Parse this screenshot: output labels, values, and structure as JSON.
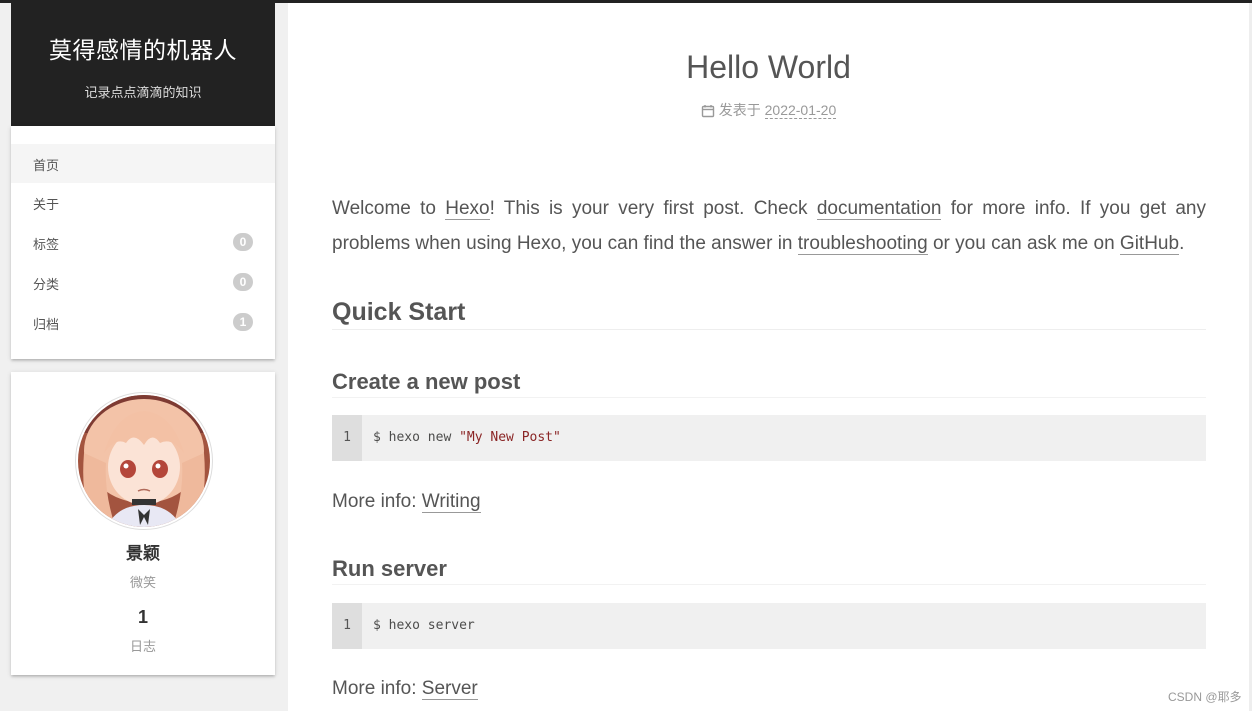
{
  "site": {
    "title": "莫得感情的机器人",
    "subtitle": "记录点点滴滴的知识"
  },
  "menu": {
    "items": [
      {
        "label": "首页",
        "badge": null
      },
      {
        "label": "关于",
        "badge": null
      },
      {
        "label": "标签",
        "badge": "0"
      },
      {
        "label": "分类",
        "badge": "0"
      },
      {
        "label": "归档",
        "badge": "1"
      }
    ]
  },
  "profile": {
    "name": "景颖",
    "description": "微笑",
    "posts_count": "1",
    "posts_label": "日志"
  },
  "post": {
    "title": "Hello World",
    "meta_prefix": "发表于",
    "date": "2022-01-20",
    "intro": {
      "t1": "Welcome to ",
      "link_hexo": "Hexo",
      "t2": "! This is your very first post. Check ",
      "link_docs": "documentation",
      "t3": " for more info. If you get any problems when using Hexo, you can find the answer in ",
      "link_trouble": "troubleshooting",
      "t4": " or you can ask me on ",
      "link_github": "GitHub",
      "t5": "."
    },
    "h_quick_start": "Quick Start",
    "h_create": "Create a new post",
    "code1": {
      "line": "1",
      "cmd": "$ hexo new ",
      "arg": "\"My New Post\""
    },
    "more1": {
      "prefix": "More info: ",
      "link": "Writing"
    },
    "h_run": "Run server",
    "code2": {
      "line": "1",
      "cmd": "$ hexo server"
    },
    "more2": {
      "prefix": "More info: ",
      "link": "Server"
    }
  },
  "watermark": "CSDN @耶多",
  "icons": {
    "date": "calendar-icon"
  }
}
